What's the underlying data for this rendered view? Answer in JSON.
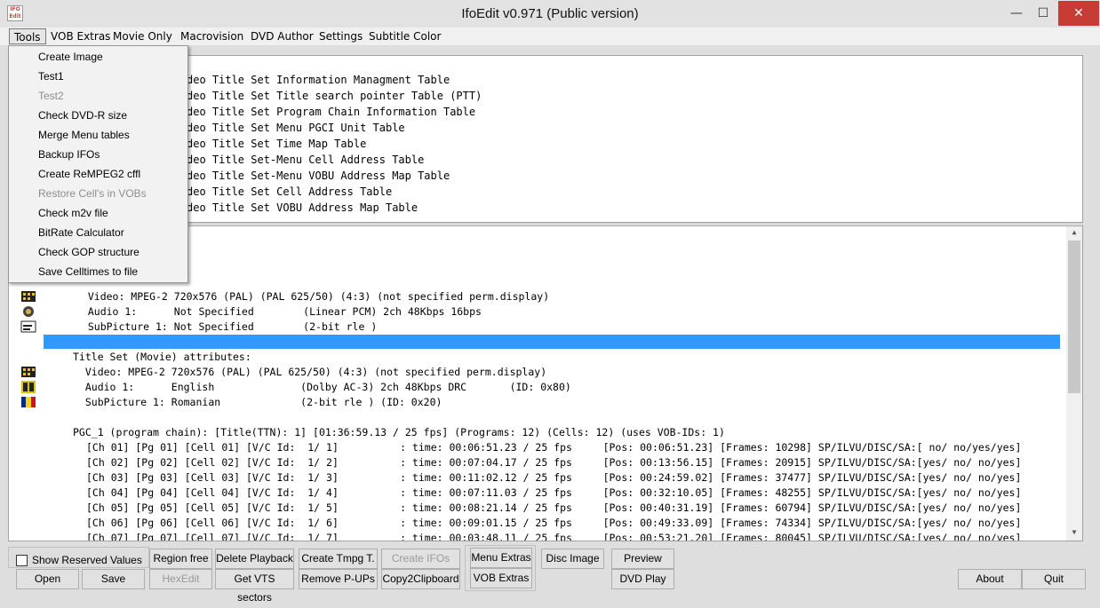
{
  "window": {
    "title": "IfoEdit v0.971 (Public version)",
    "minimize": "—",
    "maximize": "☐",
    "close": "✕",
    "app_icon": "IFO Edit"
  },
  "menubar": [
    "Tools",
    "VOB Extras",
    "Movie Only",
    "Macrovision",
    "DVD Author",
    "Settings",
    "Subtitle Color"
  ],
  "tools_menu": {
    "items": [
      {
        "label": "Create Image",
        "enabled": true
      },
      {
        "label": "Test1",
        "enabled": true
      },
      {
        "label": "Test2",
        "enabled": false
      },
      {
        "label": "Check DVD-R size",
        "enabled": true
      },
      {
        "label": "Merge Menu tables",
        "enabled": true
      },
      {
        "label": "Backup IFOs",
        "enabled": true
      },
      {
        "label": "Create ReMPEG2 cffl",
        "enabled": true
      },
      {
        "label": "Restore Cell's in VOBs",
        "enabled": false
      },
      {
        "label": "Check m2v file",
        "enabled": true
      },
      {
        "label": "BitRate Calculator",
        "enabled": true
      },
      {
        "label": "Check GOP structure",
        "enabled": true
      },
      {
        "label": "Save Celltimes to file",
        "enabled": true
      }
    ]
  },
  "top_list": [
    "deo Title Set Information Managment Table",
    "deo Title Set Title search pointer Table (PTT)",
    "deo Title Set Program Chain Information Table",
    "deo Title Set Menu PGCI Unit Table",
    "deo Title Set Time Map Table",
    "deo Title Set-Menu Cell Address Table",
    "deo Title Set-Menu VOBU Address Map Table",
    "deo Title Set Cell Address Table",
    "deo Title Set VOBU Address Map Table"
  ],
  "main_lines": {
    "menu_video": "  Video: MPEG-2 720x576 (PAL) (PAL 625/50) (4:3) (not specified perm.display)",
    "menu_audio": "  Audio 1:      Not Specified        (Linear PCM) 2ch 48Kbps 16bps",
    "menu_sub": "  SubPicture 1: Not Specified        (2-bit rle )",
    "title_set": "Title Set (Movie) attributes:",
    "ts_video": "  Video: MPEG-2 720x576 (PAL) (PAL 625/50) (4:3) (not specified perm.display)",
    "ts_audio": "  Audio 1:      English              (Dolby AC-3) 2ch 48Kbps DRC       (ID: 0x80)",
    "ts_sub": "  SubPicture 1: Romanian             (2-bit rle ) (ID: 0x20)",
    "pgc": "PGC_1 (program chain): [Title(TTN): 1] [01:36:59.13 / 25 fps] (Programs: 12) (Cells: 12) (uses VOB-IDs: 1)"
  },
  "cells": [
    "[Ch 01] [Pg 01] [Cell 01] [V/C Id:  1/ 1]          : time: 00:06:51.23 / 25 fps     [Pos: 00:06:51.23] [Frames: 10298] SP/ILVU/DISC/SA:[ no/ no/yes/yes]",
    "[Ch 02] [Pg 02] [Cell 02] [V/C Id:  1/ 2]          : time: 00:07:04.17 / 25 fps     [Pos: 00:13:56.15] [Frames: 20915] SP/ILVU/DISC/SA:[yes/ no/ no/yes]",
    "[Ch 03] [Pg 03] [Cell 03] [V/C Id:  1/ 3]          : time: 00:11:02.12 / 25 fps     [Pos: 00:24:59.02] [Frames: 37477] SP/ILVU/DISC/SA:[yes/ no/ no/yes]",
    "[Ch 04] [Pg 04] [Cell 04] [V/C Id:  1/ 4]          : time: 00:07:11.03 / 25 fps     [Pos: 00:32:10.05] [Frames: 48255] SP/ILVU/DISC/SA:[yes/ no/ no/yes]",
    "[Ch 05] [Pg 05] [Cell 05] [V/C Id:  1/ 5]          : time: 00:08:21.14 / 25 fps     [Pos: 00:40:31.19] [Frames: 60794] SP/ILVU/DISC/SA:[yes/ no/ no/yes]",
    "[Ch 06] [Pg 06] [Cell 06] [V/C Id:  1/ 6]          : time: 00:09:01.15 / 25 fps     [Pos: 00:49:33.09] [Frames: 74334] SP/ILVU/DISC/SA:[yes/ no/ no/yes]",
    "[Ch 07] [Pg 07] [Cell 07] [V/C Id:  1/ 7]          : time: 00:03:48.11 / 25 fps     [Pos: 00:53:21.20] [Frames: 80045] SP/ILVU/DISC/SA:[yes/ no/ no/yes]"
  ],
  "bottom": {
    "show_reserved": "Show Reserved Values",
    "region_free": "Region free",
    "delete_playback": "Delete Playback",
    "create_tmpg": "Create Tmpg T.",
    "create_ifos": "Create IFOs",
    "menu_extras": "Menu Extras",
    "disc_image": "Disc Image",
    "preview": "Preview",
    "open": "Open",
    "save": "Save",
    "hexedit": "HexEdit",
    "get_vts": "Get VTS sectors",
    "remove_pups": "Remove P-UPs",
    "copy2clip": "Copy2Clipboard",
    "vob_extras": "VOB Extras",
    "dvd_play": "DVD Play",
    "about": "About",
    "quit": "Quit"
  }
}
